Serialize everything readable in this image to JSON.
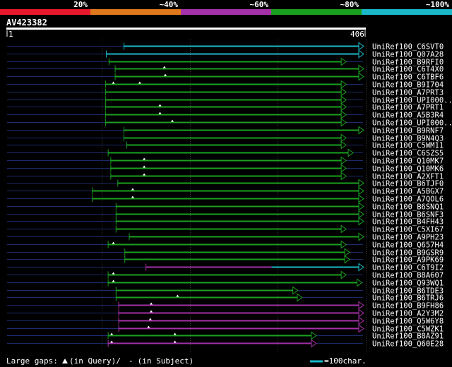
{
  "colors": {
    "background": "#000000",
    "red": "#e8192e",
    "orange": "#e0781c",
    "purple": "#a431a8",
    "green": "#1aa020",
    "cyan": "#1ab8c8",
    "query_bar": "#ffffff",
    "dim_line": "#1d2b6b",
    "grid": "#3a3a3a"
  },
  "legend_scale": {
    "labels": [
      "20%",
      "~40%",
      "~60%",
      "~80%",
      "~100%"
    ],
    "colors": [
      "red",
      "orange",
      "purple",
      "green",
      "cyan"
    ]
  },
  "query": {
    "id": "AV423382",
    "start_label": "1",
    "end_label": "406",
    "length": 406
  },
  "hits": [
    {
      "name": "UniRef100_C6SVT0",
      "start": 134,
      "end": 406,
      "color": "cyan",
      "gaps": []
    },
    {
      "name": "UniRef100_Q07A28",
      "start": 114,
      "end": 406,
      "color": "cyan",
      "gaps": []
    },
    {
      "name": "UniRef100_B9RFI0",
      "start": 117,
      "end": 386,
      "color": "green",
      "gaps": []
    },
    {
      "name": "UniRef100_C6T4X0",
      "start": 124,
      "end": 406,
      "color": "green",
      "gaps": [
        180
      ]
    },
    {
      "name": "UniRef100_C6TBF6",
      "start": 124,
      "end": 406,
      "color": "green",
      "gaps": [
        181
      ]
    },
    {
      "name": "UniRef100_B9I704",
      "start": 113,
      "end": 386,
      "color": "green",
      "gaps": [
        122,
        152
      ]
    },
    {
      "name": "UniRef100_A7PRT3",
      "start": 113,
      "end": 386,
      "color": "green",
      "gaps": []
    },
    {
      "name": "UniRef100_UPI000..",
      "start": 113,
      "end": 386,
      "color": "green",
      "gaps": []
    },
    {
      "name": "UniRef100_A7PRT1",
      "start": 113,
      "end": 386,
      "color": "green",
      "gaps": [
        175
      ]
    },
    {
      "name": "UniRef100_A5B3R4",
      "start": 113,
      "end": 386,
      "color": "green",
      "gaps": [
        175
      ]
    },
    {
      "name": "UniRef100_UPI000..",
      "start": 113,
      "end": 386,
      "color": "green",
      "gaps": [
        189
      ]
    },
    {
      "name": "UniRef100_B9RNF7",
      "start": 134,
      "end": 406,
      "color": "green",
      "gaps": []
    },
    {
      "name": "UniRef100_B9N4Q3",
      "start": 134,
      "end": 386,
      "color": "green",
      "gaps": []
    },
    {
      "name": "UniRef100_C5WM11",
      "start": 137,
      "end": 386,
      "color": "green",
      "gaps": []
    },
    {
      "name": "UniRef100_C6SZS5",
      "start": 116,
      "end": 394,
      "color": "green",
      "gaps": []
    },
    {
      "name": "UniRef100_Q10MK7",
      "start": 119,
      "end": 386,
      "color": "green",
      "gaps": [
        157
      ]
    },
    {
      "name": "UniRef100_Q10MK6",
      "start": 119,
      "end": 386,
      "color": "green",
      "gaps": [
        157
      ]
    },
    {
      "name": "UniRef100_A2XFT1",
      "start": 119,
      "end": 386,
      "color": "green",
      "gaps": [
        157
      ]
    },
    {
      "name": "UniRef100_B6TJF0",
      "start": 127,
      "end": 406,
      "color": "green",
      "gaps": []
    },
    {
      "name": "UniRef100_A5BGX7",
      "start": 98,
      "end": 406,
      "color": "green",
      "gaps": [
        144
      ]
    },
    {
      "name": "UniRef100_A7QOL6",
      "start": 98,
      "end": 406,
      "color": "green",
      "gaps": [
        144
      ]
    },
    {
      "name": "UniRef100_B6SNQ1",
      "start": 125,
      "end": 406,
      "color": "green",
      "gaps": []
    },
    {
      "name": "UniRef100_B6SNF3",
      "start": 125,
      "end": 406,
      "color": "green",
      "gaps": []
    },
    {
      "name": "UniRef100_B4FH43",
      "start": 125,
      "end": 406,
      "color": "green",
      "gaps": []
    },
    {
      "name": "UniRef100_C5XI67",
      "start": 125,
      "end": 386,
      "color": "green",
      "gaps": []
    },
    {
      "name": "UniRef100_A9PH23",
      "start": 140,
      "end": 406,
      "color": "green",
      "gaps": []
    },
    {
      "name": "UniRef100_Q657H4",
      "start": 116,
      "end": 386,
      "color": "green",
      "gaps": [
        122
      ]
    },
    {
      "name": "UniRef100_B9GSR9",
      "start": 135,
      "end": 390,
      "color": "green",
      "gaps": []
    },
    {
      "name": "UniRef100_A9PK69",
      "start": 135,
      "end": 390,
      "color": "green",
      "gaps": []
    },
    {
      "name": "UniRef100_C6T9I2",
      "start": 159,
      "end": 406,
      "color": "purple",
      "color2": "cyan",
      "split": 302,
      "gaps": []
    },
    {
      "name": "UniRef100_B8A607",
      "start": 116,
      "end": 386,
      "color": "green",
      "gaps": [
        122
      ]
    },
    {
      "name": "UniRef100_Q93WQ1",
      "start": 116,
      "end": 404,
      "color": "green",
      "gaps": [
        122
      ]
    },
    {
      "name": "UniRef100_B6TDE3",
      "start": 125,
      "end": 331,
      "color": "green",
      "gaps": []
    },
    {
      "name": "UniRef100_B6TRJ6",
      "start": 125,
      "end": 336,
      "color": "green",
      "gaps": [
        195
      ]
    },
    {
      "name": "UniRef100_B9FH86",
      "start": 128,
      "end": 406,
      "color": "purple",
      "gaps": [
        165
      ]
    },
    {
      "name": "UniRef100_A2Y3M2",
      "start": 128,
      "end": 406,
      "color": "purple",
      "gaps": [
        165
      ]
    },
    {
      "name": "UniRef100_Q5W6Y8",
      "start": 128,
      "end": 406,
      "color": "purple",
      "gaps": [
        164
      ]
    },
    {
      "name": "UniRef100_C5WZK1",
      "start": 128,
      "end": 406,
      "color": "purple",
      "gaps": [
        162
      ]
    },
    {
      "name": "UniRef100_B8AZ91",
      "start": 116,
      "end": 352,
      "color": "green",
      "gaps": [
        120,
        192
      ]
    },
    {
      "name": "UniRef100_Q60E28",
      "start": 116,
      "end": 352,
      "color": "purple",
      "gaps": [
        120,
        192
      ]
    }
  ],
  "footer": {
    "large_gaps_label": "Large gaps:",
    "in_query_label": "(in Query)/",
    "dash_glyph": "-",
    "in_subject_label": " (in Subject)",
    "scale_label": "=100char."
  }
}
